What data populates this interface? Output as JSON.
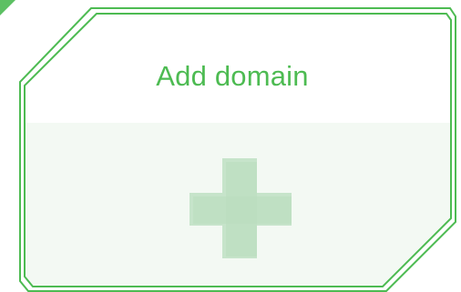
{
  "add_domain_card": {
    "label": "Add domain",
    "icon": "plus-icon",
    "border_color": "#4dbb52",
    "body_fill": "#f3f9f3",
    "icon_color": "#c4e3c8"
  }
}
